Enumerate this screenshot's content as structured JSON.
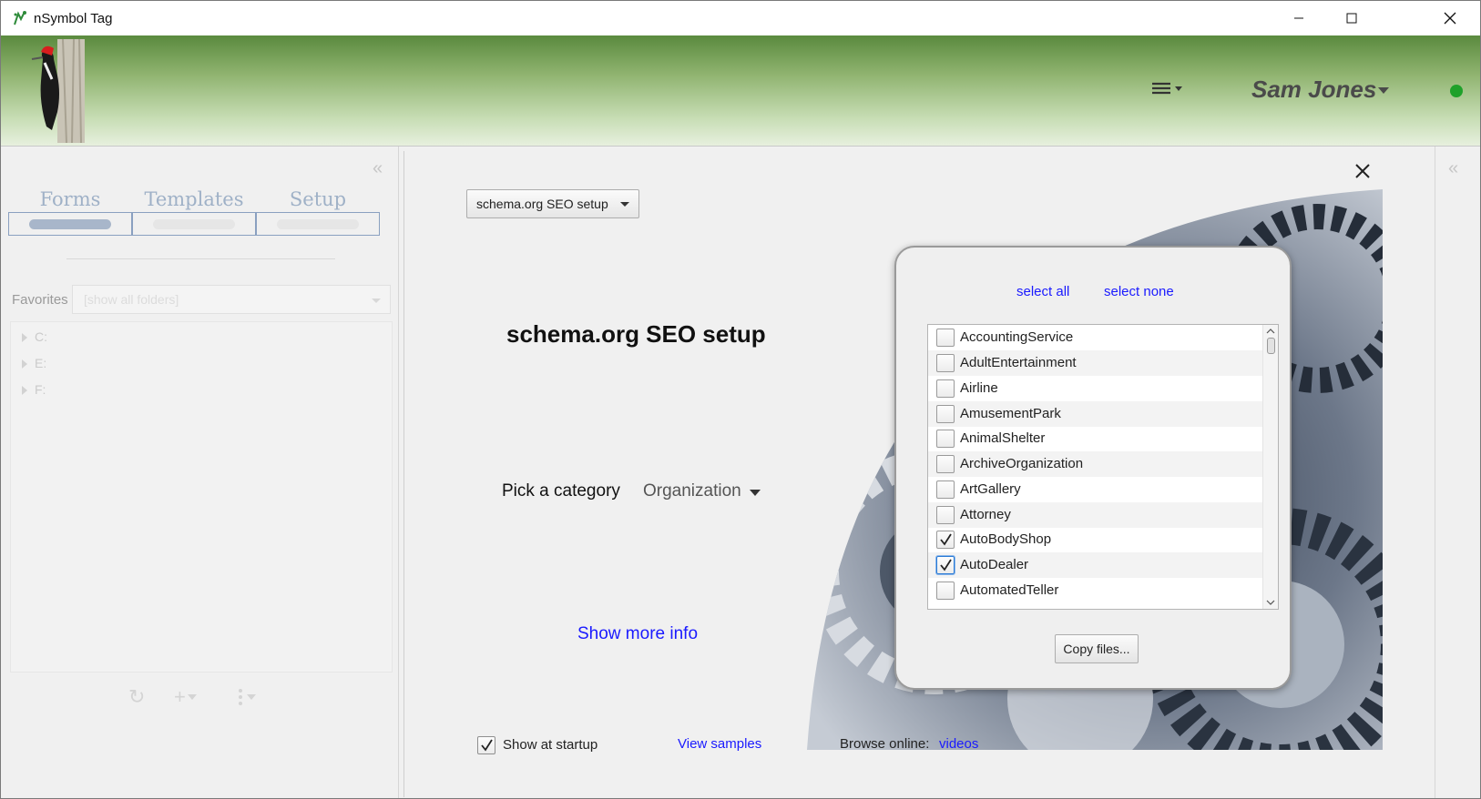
{
  "window": {
    "title": "nSymbol Tag"
  },
  "header": {
    "user_name": "Sam Jones",
    "status_color": "#1fa12a"
  },
  "left_panel": {
    "tabs": [
      {
        "label": "Forms"
      },
      {
        "label": "Templates"
      },
      {
        "label": "Setup"
      }
    ],
    "favorites_label": "Favorites",
    "favorites_value": "[show all folders]",
    "tree": [
      {
        "label": "C:"
      },
      {
        "label": "E:"
      },
      {
        "label": "F:"
      }
    ]
  },
  "main": {
    "setup_dropdown": "schema.org SEO setup",
    "heading": "schema.org SEO setup",
    "pick_label": "Pick a category",
    "category_value": "Organization",
    "show_more": "Show more info",
    "dialog": {
      "select_all": "select all",
      "select_none": "select none",
      "items": [
        {
          "label": "AccountingService",
          "checked": false
        },
        {
          "label": "AdultEntertainment",
          "checked": false
        },
        {
          "label": "Airline",
          "checked": false
        },
        {
          "label": "AmusementPark",
          "checked": false
        },
        {
          "label": "AnimalShelter",
          "checked": false
        },
        {
          "label": "ArchiveOrganization",
          "checked": false
        },
        {
          "label": "ArtGallery",
          "checked": false
        },
        {
          "label": "Attorney",
          "checked": false
        },
        {
          "label": "AutoBodyShop",
          "checked": true
        },
        {
          "label": "AutoDealer",
          "checked": true
        },
        {
          "label": "AutomatedTeller",
          "checked": false
        }
      ],
      "copy_button": "Copy files..."
    },
    "footer": {
      "show_at_startup": "Show at startup",
      "show_at_startup_checked": true,
      "view_samples": "View samples",
      "browse_online": "Browse online:",
      "videos": "videos"
    }
  }
}
